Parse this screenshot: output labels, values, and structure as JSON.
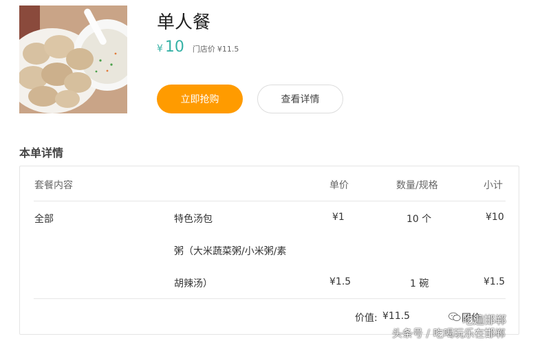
{
  "product": {
    "image_icon": "food-photo",
    "title": "单人餐",
    "price_symbol": "¥",
    "price": "10",
    "store_price_label": "门店价",
    "store_price": "¥11.5"
  },
  "actions": {
    "buy_label": "立即抢购",
    "detail_label": "查看详情"
  },
  "details": {
    "section_title": "本单详情",
    "headers": {
      "content": "套餐内容",
      "unit_price": "单价",
      "quantity": "数量/规格",
      "subtotal": "小计"
    },
    "category": "全部",
    "items": [
      {
        "name": "特色汤包",
        "unit_price": "¥1",
        "quantity": "10 个",
        "subtotal": "¥10"
      },
      {
        "name_line1": "粥（大米蔬菜粥/小米粥/素",
        "name_line2": "胡辣汤）",
        "unit_price": "¥1.5",
        "quantity": "1 碗",
        "subtotal": "¥1.5"
      }
    ],
    "total_label": "价值:",
    "total_value": "¥11.5",
    "footer_fragment": "团价"
  },
  "watermark": {
    "line1": "吃遍邯郸",
    "line2": "头条号 / 吃喝玩乐在邯郸",
    "icon": "wechat-icon"
  },
  "colors": {
    "accent_price": "#36b2a6",
    "buy_button": "#ff9b00",
    "border": "#e4e4e4"
  }
}
